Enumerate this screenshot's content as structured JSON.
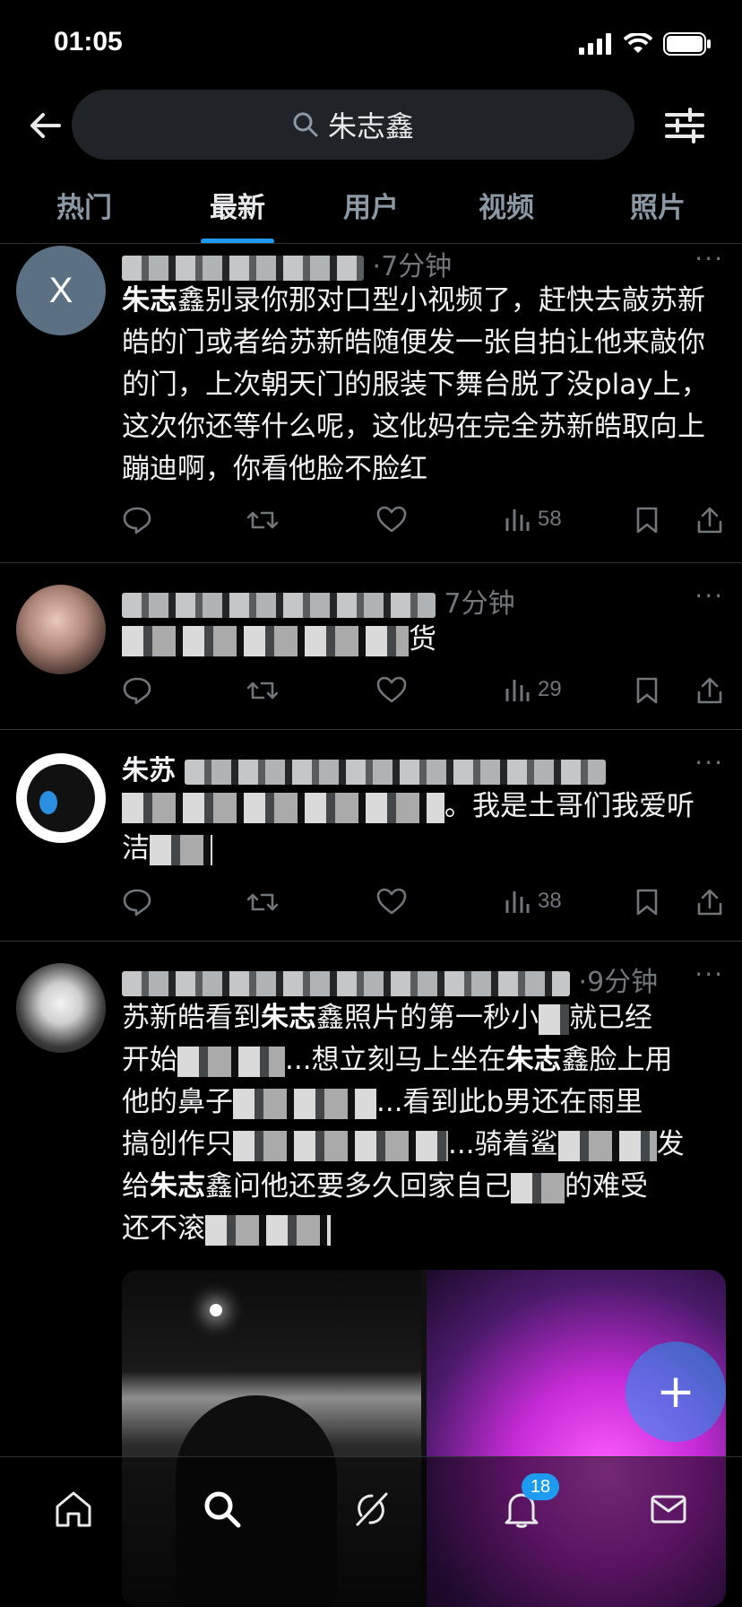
{
  "status_bar": {
    "time": "01:05"
  },
  "header": {
    "search_query": "朱志鑫"
  },
  "tabs": [
    {
      "label": "热门",
      "active": false
    },
    {
      "label": "最新",
      "active": true
    },
    {
      "label": "用户",
      "active": false
    },
    {
      "label": "视频",
      "active": false
    },
    {
      "label": "照片",
      "active": false
    }
  ],
  "tweets": [
    {
      "avatar_letter": "X",
      "time": "7分钟",
      "text_hl": "朱志",
      "text": "鑫别录你那对口型小视频了，赶快去敲苏新皓的门或者给苏新皓随便发一张自拍让他来敲你的门，上次朝天门的服装下舞台脱了没play上，这次你还等什么呢，这仳妈在完全苏新皓取向上蹦迪啊，你看他脸不脸红",
      "views": "58"
    },
    {
      "time": "7分钟",
      "text_tail": "货",
      "views": "29"
    },
    {
      "name_visible": "朱苏",
      "text_visible": "。我是土哥们我爱听",
      "text_line2": "洁",
      "views": "38"
    },
    {
      "time": "9分钟",
      "line1": "苏新皓看到",
      "line1_hl": "朱志",
      "line1_tail": "鑫照片的第一秒小",
      "line1_end": "就已经",
      "line2": "开始",
      "line2_tail": "...想立刻马上坐在",
      "line2_hl": "朱志",
      "line2_end": "鑫脸上用",
      "line3": "他的鼻子",
      "line3_tail": "...看到此b男还在雨里",
      "line4": "搞创作只",
      "line4_tail": "...骑着鲨",
      "line4_end": "发",
      "line5": "给",
      "line5_hl": "朱志",
      "line5_tail": "鑫问他还要多久回家自己",
      "line5_end": "的难受",
      "line6": "还不滚"
    }
  ],
  "bottom_nav": {
    "notification_count": "18"
  },
  "fab": {
    "label": "+"
  }
}
